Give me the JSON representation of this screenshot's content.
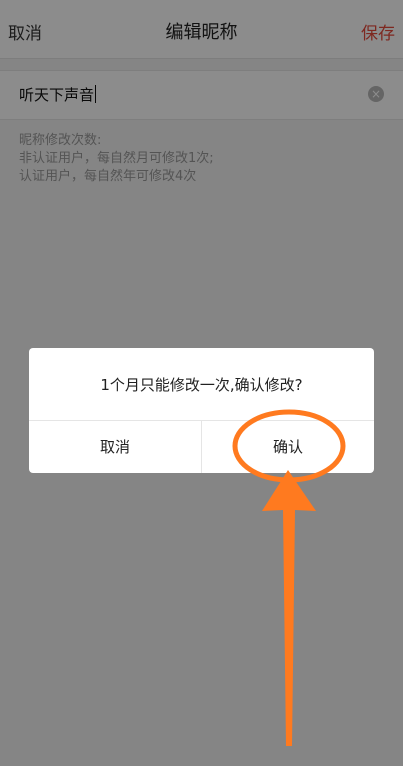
{
  "nav": {
    "cancel": "取消",
    "title": "编辑昵称",
    "save": "保存"
  },
  "field": {
    "value": "听天下声音",
    "clear_icon": "clear-icon"
  },
  "tips": {
    "line1": "昵称修改次数:",
    "line2": "非认证用户，每自然月可修改1次;",
    "line3": "认证用户，每自然年可修改4次"
  },
  "dialog": {
    "message": "1个月只能修改一次,确认修改?",
    "cancel": "取消",
    "confirm": "确认"
  },
  "colors": {
    "accent": "#e64a3b",
    "annotation": "#ff7a1f"
  }
}
